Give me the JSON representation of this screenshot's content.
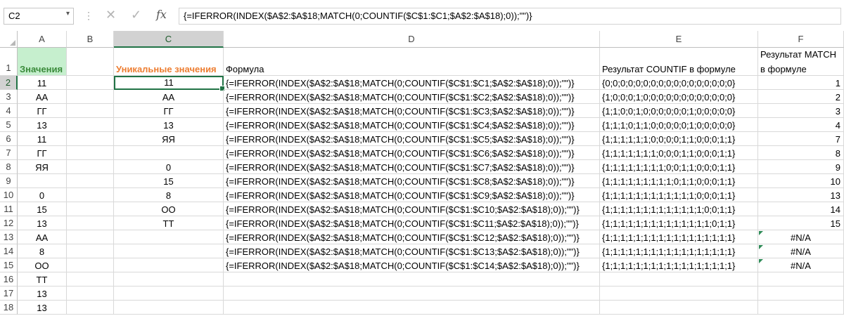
{
  "formula_bar": {
    "name_box": "C2",
    "name_box_arrow": "▾",
    "dots": "⋮",
    "cancel_glyph": "✕",
    "enter_glyph": "✓",
    "fx": "fx",
    "formula": "{=IFERROR(INDEX($A$2:$A$18;MATCH(0;COUNTIF($C$1:$C1;$A$2:$A$18);0));\"\")}"
  },
  "columns": [
    "A",
    "B",
    "C",
    "D",
    "E",
    "F"
  ],
  "rows": [
    "1",
    "2",
    "3",
    "4",
    "5",
    "6",
    "7",
    "8",
    "9",
    "10",
    "11",
    "12",
    "13",
    "14",
    "15",
    "16",
    "17",
    "18"
  ],
  "header_row": {
    "A": "Значения",
    "C": "Уникальные значения",
    "D": "Формула",
    "E": "Результат COUNTIF в формуле",
    "F_line1": "Результат MATCH",
    "F_line2": "в формуле"
  },
  "col_a": [
    "11",
    "АА",
    "ГГ",
    "13",
    "11",
    "ГГ",
    "ЯЯ",
    "",
    "0",
    "15",
    "13",
    "АА",
    "8",
    "ОО",
    "ТТ",
    "13",
    "13"
  ],
  "col_c": [
    "11",
    "АА",
    "ГГ",
    "13",
    "ЯЯ",
    "",
    "0",
    "15",
    "8",
    "ОО",
    "ТТ",
    "",
    "",
    "",
    "",
    "",
    ""
  ],
  "col_d": [
    "{=IFERROR(INDEX($A$2:$A$18;MATCH(0;COUNTIF($C$1:$C1;$A$2:$A$18);0));\"\")}",
    "{=IFERROR(INDEX($A$2:$A$18;MATCH(0;COUNTIF($C$1:$C2;$A$2:$A$18);0));\"\")}",
    "{=IFERROR(INDEX($A$2:$A$18;MATCH(0;COUNTIF($C$1:$C3;$A$2:$A$18);0));\"\")}",
    "{=IFERROR(INDEX($A$2:$A$18;MATCH(0;COUNTIF($C$1:$C4;$A$2:$A$18);0));\"\")}",
    "{=IFERROR(INDEX($A$2:$A$18;MATCH(0;COUNTIF($C$1:$C5;$A$2:$A$18);0));\"\")}",
    "{=IFERROR(INDEX($A$2:$A$18;MATCH(0;COUNTIF($C$1:$C6;$A$2:$A$18);0));\"\")}",
    "{=IFERROR(INDEX($A$2:$A$18;MATCH(0;COUNTIF($C$1:$C7;$A$2:$A$18);0));\"\")}",
    "{=IFERROR(INDEX($A$2:$A$18;MATCH(0;COUNTIF($C$1:$C8;$A$2:$A$18);0));\"\")}",
    "{=IFERROR(INDEX($A$2:$A$18;MATCH(0;COUNTIF($C$1:$C9;$A$2:$A$18);0));\"\")}",
    "{=IFERROR(INDEX($A$2:$A$18;MATCH(0;COUNTIF($C$1:$C10;$A$2:$A$18);0));\"\")}",
    "{=IFERROR(INDEX($A$2:$A$18;MATCH(0;COUNTIF($C$1:$C11;$A$2:$A$18);0));\"\")}",
    "{=IFERROR(INDEX($A$2:$A$18;MATCH(0;COUNTIF($C$1:$C12;$A$2:$A$18);0));\"\")}",
    "{=IFERROR(INDEX($A$2:$A$18;MATCH(0;COUNTIF($C$1:$C13;$A$2:$A$18);0));\"\")}",
    "{=IFERROR(INDEX($A$2:$A$18;MATCH(0;COUNTIF($C$1:$C14;$A$2:$A$18);0));\"\")}",
    "",
    "",
    ""
  ],
  "col_e": [
    "{0;0;0;0;0;0;0;0;0;0;0;0;0;0;0;0;0}",
    "{1;0;0;0;1;0;0;0;0;0;0;0;0;0;0;0;0}",
    "{1;1;0;0;1;0;0;0;0;0;0;1;0;0;0;0;0}",
    "{1;1;1;0;1;1;0;0;0;0;0;1;0;0;0;0;0}",
    "{1;1;1;1;1;1;0;0;0;0;1;1;0;0;0;1;1}",
    "{1;1;1;1;1;1;1;0;0;0;1;1;0;0;0;1;1}",
    "{1;1;1;1;1;1;1;1;0;0;1;1;0;0;0;1;1}",
    "{1;1;1;1;1;1;1;1;1;0;1;1;0;0;0;1;1}",
    "{1;1;1;1;1;1;1;1;1;1;1;1;0;0;0;1;1}",
    "{1;1;1;1;1;1;1;1;1;1;1;1;1;0;0;1;1}",
    "{1;1;1;1;1;1;1;1;1;1;1;1;1;1;0;1;1}",
    "{1;1;1;1;1;1;1;1;1;1;1;1;1;1;1;1;1}",
    "{1;1;1;1;1;1;1;1;1;1;1;1;1;1;1;1;1}",
    "{1;1;1;1;1;1;1;1;1;1;1;1;1;1;1;1;1}",
    "",
    "",
    ""
  ],
  "col_f": [
    "1",
    "2",
    "3",
    "4",
    "7",
    "8",
    "9",
    "10",
    "13",
    "14",
    "15",
    "#N/A",
    "#N/A",
    "#N/A",
    "",
    "",
    ""
  ],
  "colors": {
    "accent": "#217346",
    "a1_fill": "#c6efce",
    "a1_text": "#3a8a3a",
    "c1_text": "#ed7d31",
    "error_indicator": "#2e8b57"
  }
}
